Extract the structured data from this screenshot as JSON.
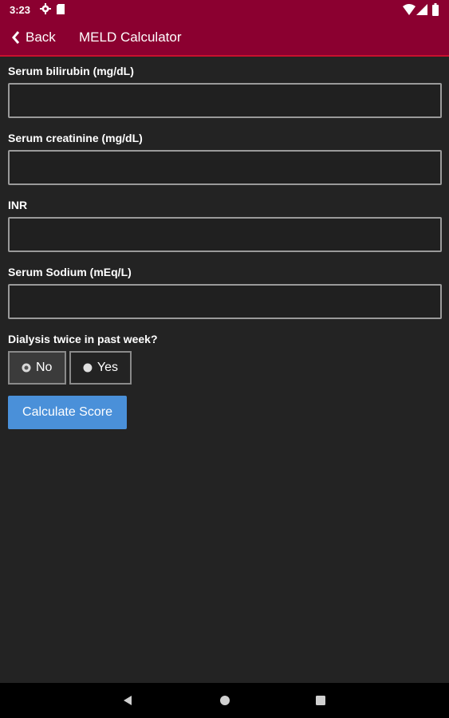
{
  "status_bar": {
    "time": "3:23",
    "icons": [
      "gear-icon",
      "sd-card-icon",
      "wifi-icon",
      "signal-icon",
      "battery-icon"
    ]
  },
  "app_bar": {
    "back_label": "Back",
    "title": "MELD Calculator",
    "color": "#8b0030"
  },
  "form": {
    "fields": [
      {
        "label": "Serum bilirubin (mg/dL)",
        "value": ""
      },
      {
        "label": "Serum creatinine (mg/dL)",
        "value": ""
      },
      {
        "label": "INR",
        "value": ""
      },
      {
        "label": "Serum Sodium (mEq/L)",
        "value": ""
      }
    ],
    "dialysis": {
      "label": "Dialysis twice in past week?",
      "options": [
        {
          "label": "No",
          "selected": true
        },
        {
          "label": "Yes",
          "selected": false
        }
      ]
    },
    "calculate_label": "Calculate Score",
    "button_color": "#4a90d9"
  },
  "nav_bar": {
    "icons": [
      "back-triangle-icon",
      "home-circle-icon",
      "recents-square-icon"
    ]
  }
}
